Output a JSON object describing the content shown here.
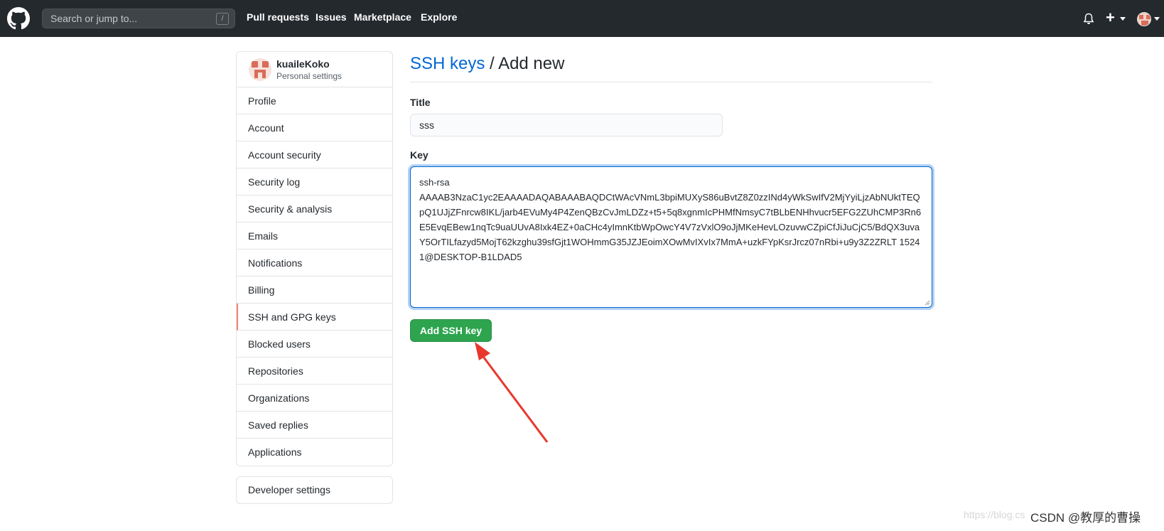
{
  "header": {
    "search_placeholder": "Search or jump to...",
    "search_shortcut": "/",
    "nav": [
      "Pull requests",
      "Issues",
      "Marketplace",
      "Explore"
    ],
    "plus_label": "+"
  },
  "sidebar": {
    "username": "kuaileKoko",
    "subtitle": "Personal settings",
    "items": [
      {
        "label": "Profile"
      },
      {
        "label": "Account"
      },
      {
        "label": "Account security"
      },
      {
        "label": "Security log"
      },
      {
        "label": "Security & analysis"
      },
      {
        "label": "Emails"
      },
      {
        "label": "Notifications"
      },
      {
        "label": "Billing"
      },
      {
        "label": "SSH and GPG keys",
        "selected": true
      },
      {
        "label": "Blocked users"
      },
      {
        "label": "Repositories"
      },
      {
        "label": "Organizations"
      },
      {
        "label": "Saved replies"
      },
      {
        "label": "Applications"
      }
    ],
    "developer_settings": "Developer settings"
  },
  "main": {
    "breadcrumb_link": "SSH keys",
    "breadcrumb_sep": " / ",
    "breadcrumb_current": "Add new",
    "title_label": "Title",
    "title_value": "sss",
    "key_label": "Key",
    "key_value": "ssh-rsa\nAAAAB3NzaC1yc2EAAAADAQABAAABAQDCtWAcVNmL3bpiMUXyS86uBvtZ8Z0zzINd4yWkSwIfV2MjYyiLjzAbNUktTEQpQ1UJjZFnrcw8IKL/jarb4EVuMy4P4ZenQBzCvJmLDZz+t5+5q8xgnmIcPHMfNmsyC7tBLbENHhvucr5EFG2ZUhCMP3Rn6E5EvqEBew1nqTc9uaUUvA8Ixk4EZ+0aCHc4yImnKtbWpOwcY4V7zVxlO9oJjMKeHevLOzuvwCZpiCfJiJuCjC5/BdQX3uvaY5OrTILfazyd5MojT62kzghu39sfGjt1WOHmmG35JZJEoimXOwMvIXvIx7MmA+uzkFYpKsrJrcz07nRbi+u9y3Z2ZRLT 15241@DESKTOP-B1LDAD5",
    "submit_label": "Add SSH key"
  },
  "watermark": {
    "url": "https://blog.cs",
    "text": "CSDN @教厚的曹操"
  },
  "colors": {
    "header_bg": "#24292e",
    "link": "#0366d6",
    "button": "#2ea44f",
    "selected_border": "#f9826c",
    "arrow": "#e8382c"
  },
  "icons": [
    "github-logo-icon",
    "bell-icon",
    "plus-icon",
    "avatar-icon",
    "red-arrow-annotation"
  ]
}
